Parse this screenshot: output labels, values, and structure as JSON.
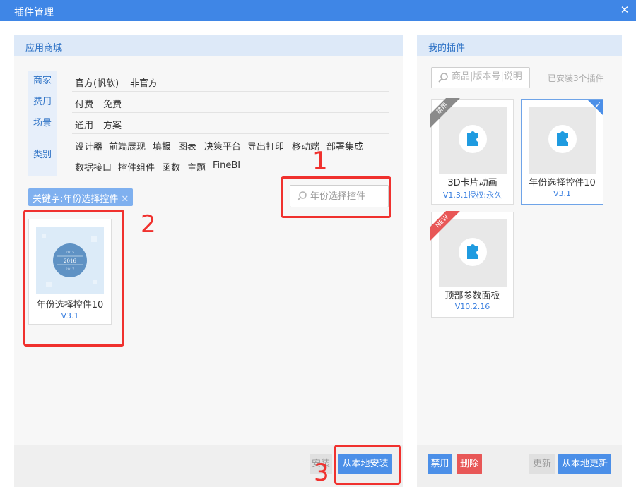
{
  "window": {
    "title": "插件管理",
    "close_icon": "close-icon"
  },
  "store": {
    "header": "应用商城",
    "filters": [
      {
        "key": "商家",
        "values": [
          "官方(帆软)",
          "非官方"
        ]
      },
      {
        "key": "费用",
        "values": [
          "付费",
          "免费"
        ]
      },
      {
        "key": "场景",
        "values": [
          "通用",
          "方案"
        ]
      },
      {
        "key": "类别",
        "values": [
          "设计器",
          "前端展现",
          "填报",
          "图表",
          "决策平台",
          "导出打印",
          "移动端",
          "部署集成",
          "数据接口",
          "控件组件",
          "函数",
          "主题",
          "FineBI"
        ]
      }
    ],
    "keyword_tag": "关键字:年份选择控件",
    "search": {
      "value": "年份选择控件",
      "placeholder": ""
    },
    "results": [
      {
        "name": "年份选择控件10",
        "version": "V3.1",
        "thumb_years": [
          "2015",
          "2016",
          "2017"
        ]
      }
    ],
    "footer": {
      "install_label": "安装",
      "install_local_label": "从本地安装"
    },
    "steps": [
      "1",
      "2",
      "3"
    ]
  },
  "mine": {
    "header": "我的插件",
    "search_placeholder": "商品|版本号|说明",
    "installed_count": "已安装3个插件",
    "plugins": [
      {
        "name": "3D卡片动画",
        "version": "V1.3.1授权:永久",
        "badge": "禁用"
      },
      {
        "name": "年份选择控件10",
        "version": "V3.1",
        "badge": ""
      },
      {
        "name": "顶部参数面板",
        "version": "V10.2.16",
        "badge": "NEW"
      }
    ],
    "footer": {
      "disable_label": "禁用",
      "delete_label": "删除",
      "update_label": "更新",
      "update_local_label": "从本地更新"
    }
  },
  "colors": {
    "accent": "#3f86e6",
    "annotation": "#f0312e",
    "disabled_badge": "#8a8a8a",
    "new_badge": "#e85757"
  }
}
